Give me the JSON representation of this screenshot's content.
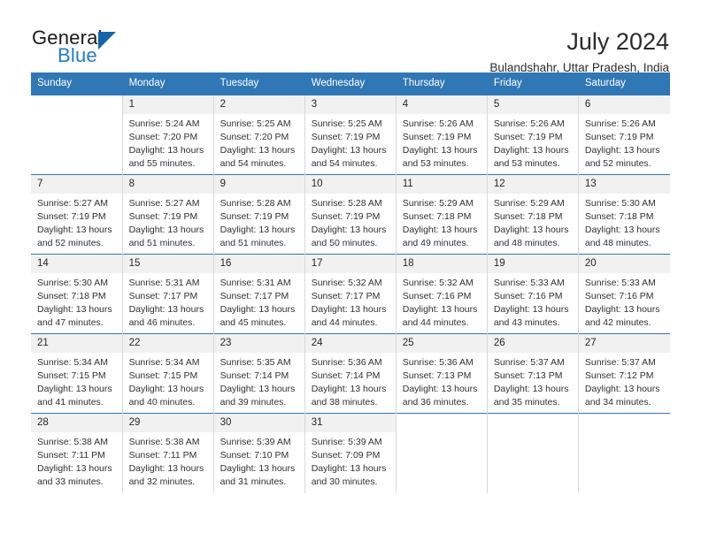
{
  "brand": {
    "name_part1": "General",
    "name_part2": "Blue",
    "logo_icon": "triangle-icon"
  },
  "header": {
    "month_title": "July 2024",
    "location": "Bulandshahr, Uttar Pradesh, India"
  },
  "colors": {
    "header_blue": "#3077b5",
    "brand_blue": "#1f7dc4",
    "daynum_bg": "#f1f1f1",
    "text": "#303030"
  },
  "calendar": {
    "weekday_headers": [
      "Sunday",
      "Monday",
      "Tuesday",
      "Wednesday",
      "Thursday",
      "Friday",
      "Saturday"
    ],
    "weeks": [
      [
        {
          "day": "",
          "sunrise": "",
          "sunset": "",
          "daylight_line1": "",
          "daylight_line2": "",
          "empty": true
        },
        {
          "day": "1",
          "sunrise": "Sunrise: 5:24 AM",
          "sunset": "Sunset: 7:20 PM",
          "daylight_line1": "Daylight: 13 hours",
          "daylight_line2": "and 55 minutes."
        },
        {
          "day": "2",
          "sunrise": "Sunrise: 5:25 AM",
          "sunset": "Sunset: 7:20 PM",
          "daylight_line1": "Daylight: 13 hours",
          "daylight_line2": "and 54 minutes."
        },
        {
          "day": "3",
          "sunrise": "Sunrise: 5:25 AM",
          "sunset": "Sunset: 7:19 PM",
          "daylight_line1": "Daylight: 13 hours",
          "daylight_line2": "and 54 minutes."
        },
        {
          "day": "4",
          "sunrise": "Sunrise: 5:26 AM",
          "sunset": "Sunset: 7:19 PM",
          "daylight_line1": "Daylight: 13 hours",
          "daylight_line2": "and 53 minutes."
        },
        {
          "day": "5",
          "sunrise": "Sunrise: 5:26 AM",
          "sunset": "Sunset: 7:19 PM",
          "daylight_line1": "Daylight: 13 hours",
          "daylight_line2": "and 53 minutes."
        },
        {
          "day": "6",
          "sunrise": "Sunrise: 5:26 AM",
          "sunset": "Sunset: 7:19 PM",
          "daylight_line1": "Daylight: 13 hours",
          "daylight_line2": "and 52 minutes."
        }
      ],
      [
        {
          "day": "7",
          "sunrise": "Sunrise: 5:27 AM",
          "sunset": "Sunset: 7:19 PM",
          "daylight_line1": "Daylight: 13 hours",
          "daylight_line2": "and 52 minutes."
        },
        {
          "day": "8",
          "sunrise": "Sunrise: 5:27 AM",
          "sunset": "Sunset: 7:19 PM",
          "daylight_line1": "Daylight: 13 hours",
          "daylight_line2": "and 51 minutes."
        },
        {
          "day": "9",
          "sunrise": "Sunrise: 5:28 AM",
          "sunset": "Sunset: 7:19 PM",
          "daylight_line1": "Daylight: 13 hours",
          "daylight_line2": "and 51 minutes."
        },
        {
          "day": "10",
          "sunrise": "Sunrise: 5:28 AM",
          "sunset": "Sunset: 7:19 PM",
          "daylight_line1": "Daylight: 13 hours",
          "daylight_line2": "and 50 minutes."
        },
        {
          "day": "11",
          "sunrise": "Sunrise: 5:29 AM",
          "sunset": "Sunset: 7:18 PM",
          "daylight_line1": "Daylight: 13 hours",
          "daylight_line2": "and 49 minutes."
        },
        {
          "day": "12",
          "sunrise": "Sunrise: 5:29 AM",
          "sunset": "Sunset: 7:18 PM",
          "daylight_line1": "Daylight: 13 hours",
          "daylight_line2": "and 48 minutes."
        },
        {
          "day": "13",
          "sunrise": "Sunrise: 5:30 AM",
          "sunset": "Sunset: 7:18 PM",
          "daylight_line1": "Daylight: 13 hours",
          "daylight_line2": "and 48 minutes."
        }
      ],
      [
        {
          "day": "14",
          "sunrise": "Sunrise: 5:30 AM",
          "sunset": "Sunset: 7:18 PM",
          "daylight_line1": "Daylight: 13 hours",
          "daylight_line2": "and 47 minutes."
        },
        {
          "day": "15",
          "sunrise": "Sunrise: 5:31 AM",
          "sunset": "Sunset: 7:17 PM",
          "daylight_line1": "Daylight: 13 hours",
          "daylight_line2": "and 46 minutes."
        },
        {
          "day": "16",
          "sunrise": "Sunrise: 5:31 AM",
          "sunset": "Sunset: 7:17 PM",
          "daylight_line1": "Daylight: 13 hours",
          "daylight_line2": "and 45 minutes."
        },
        {
          "day": "17",
          "sunrise": "Sunrise: 5:32 AM",
          "sunset": "Sunset: 7:17 PM",
          "daylight_line1": "Daylight: 13 hours",
          "daylight_line2": "and 44 minutes."
        },
        {
          "day": "18",
          "sunrise": "Sunrise: 5:32 AM",
          "sunset": "Sunset: 7:16 PM",
          "daylight_line1": "Daylight: 13 hours",
          "daylight_line2": "and 44 minutes."
        },
        {
          "day": "19",
          "sunrise": "Sunrise: 5:33 AM",
          "sunset": "Sunset: 7:16 PM",
          "daylight_line1": "Daylight: 13 hours",
          "daylight_line2": "and 43 minutes."
        },
        {
          "day": "20",
          "sunrise": "Sunrise: 5:33 AM",
          "sunset": "Sunset: 7:16 PM",
          "daylight_line1": "Daylight: 13 hours",
          "daylight_line2": "and 42 minutes."
        }
      ],
      [
        {
          "day": "21",
          "sunrise": "Sunrise: 5:34 AM",
          "sunset": "Sunset: 7:15 PM",
          "daylight_line1": "Daylight: 13 hours",
          "daylight_line2": "and 41 minutes."
        },
        {
          "day": "22",
          "sunrise": "Sunrise: 5:34 AM",
          "sunset": "Sunset: 7:15 PM",
          "daylight_line1": "Daylight: 13 hours",
          "daylight_line2": "and 40 minutes."
        },
        {
          "day": "23",
          "sunrise": "Sunrise: 5:35 AM",
          "sunset": "Sunset: 7:14 PM",
          "daylight_line1": "Daylight: 13 hours",
          "daylight_line2": "and 39 minutes."
        },
        {
          "day": "24",
          "sunrise": "Sunrise: 5:36 AM",
          "sunset": "Sunset: 7:14 PM",
          "daylight_line1": "Daylight: 13 hours",
          "daylight_line2": "and 38 minutes."
        },
        {
          "day": "25",
          "sunrise": "Sunrise: 5:36 AM",
          "sunset": "Sunset: 7:13 PM",
          "daylight_line1": "Daylight: 13 hours",
          "daylight_line2": "and 36 minutes."
        },
        {
          "day": "26",
          "sunrise": "Sunrise: 5:37 AM",
          "sunset": "Sunset: 7:13 PM",
          "daylight_line1": "Daylight: 13 hours",
          "daylight_line2": "and 35 minutes."
        },
        {
          "day": "27",
          "sunrise": "Sunrise: 5:37 AM",
          "sunset": "Sunset: 7:12 PM",
          "daylight_line1": "Daylight: 13 hours",
          "daylight_line2": "and 34 minutes."
        }
      ],
      [
        {
          "day": "28",
          "sunrise": "Sunrise: 5:38 AM",
          "sunset": "Sunset: 7:11 PM",
          "daylight_line1": "Daylight: 13 hours",
          "daylight_line2": "and 33 minutes."
        },
        {
          "day": "29",
          "sunrise": "Sunrise: 5:38 AM",
          "sunset": "Sunset: 7:11 PM",
          "daylight_line1": "Daylight: 13 hours",
          "daylight_line2": "and 32 minutes."
        },
        {
          "day": "30",
          "sunrise": "Sunrise: 5:39 AM",
          "sunset": "Sunset: 7:10 PM",
          "daylight_line1": "Daylight: 13 hours",
          "daylight_line2": "and 31 minutes."
        },
        {
          "day": "31",
          "sunrise": "Sunrise: 5:39 AM",
          "sunset": "Sunset: 7:09 PM",
          "daylight_line1": "Daylight: 13 hours",
          "daylight_line2": "and 30 minutes."
        },
        {
          "day": "",
          "sunrise": "",
          "sunset": "",
          "daylight_line1": "",
          "daylight_line2": "",
          "empty": true
        },
        {
          "day": "",
          "sunrise": "",
          "sunset": "",
          "daylight_line1": "",
          "daylight_line2": "",
          "empty": true
        },
        {
          "day": "",
          "sunrise": "",
          "sunset": "",
          "daylight_line1": "",
          "daylight_line2": "",
          "empty": true
        }
      ]
    ]
  }
}
